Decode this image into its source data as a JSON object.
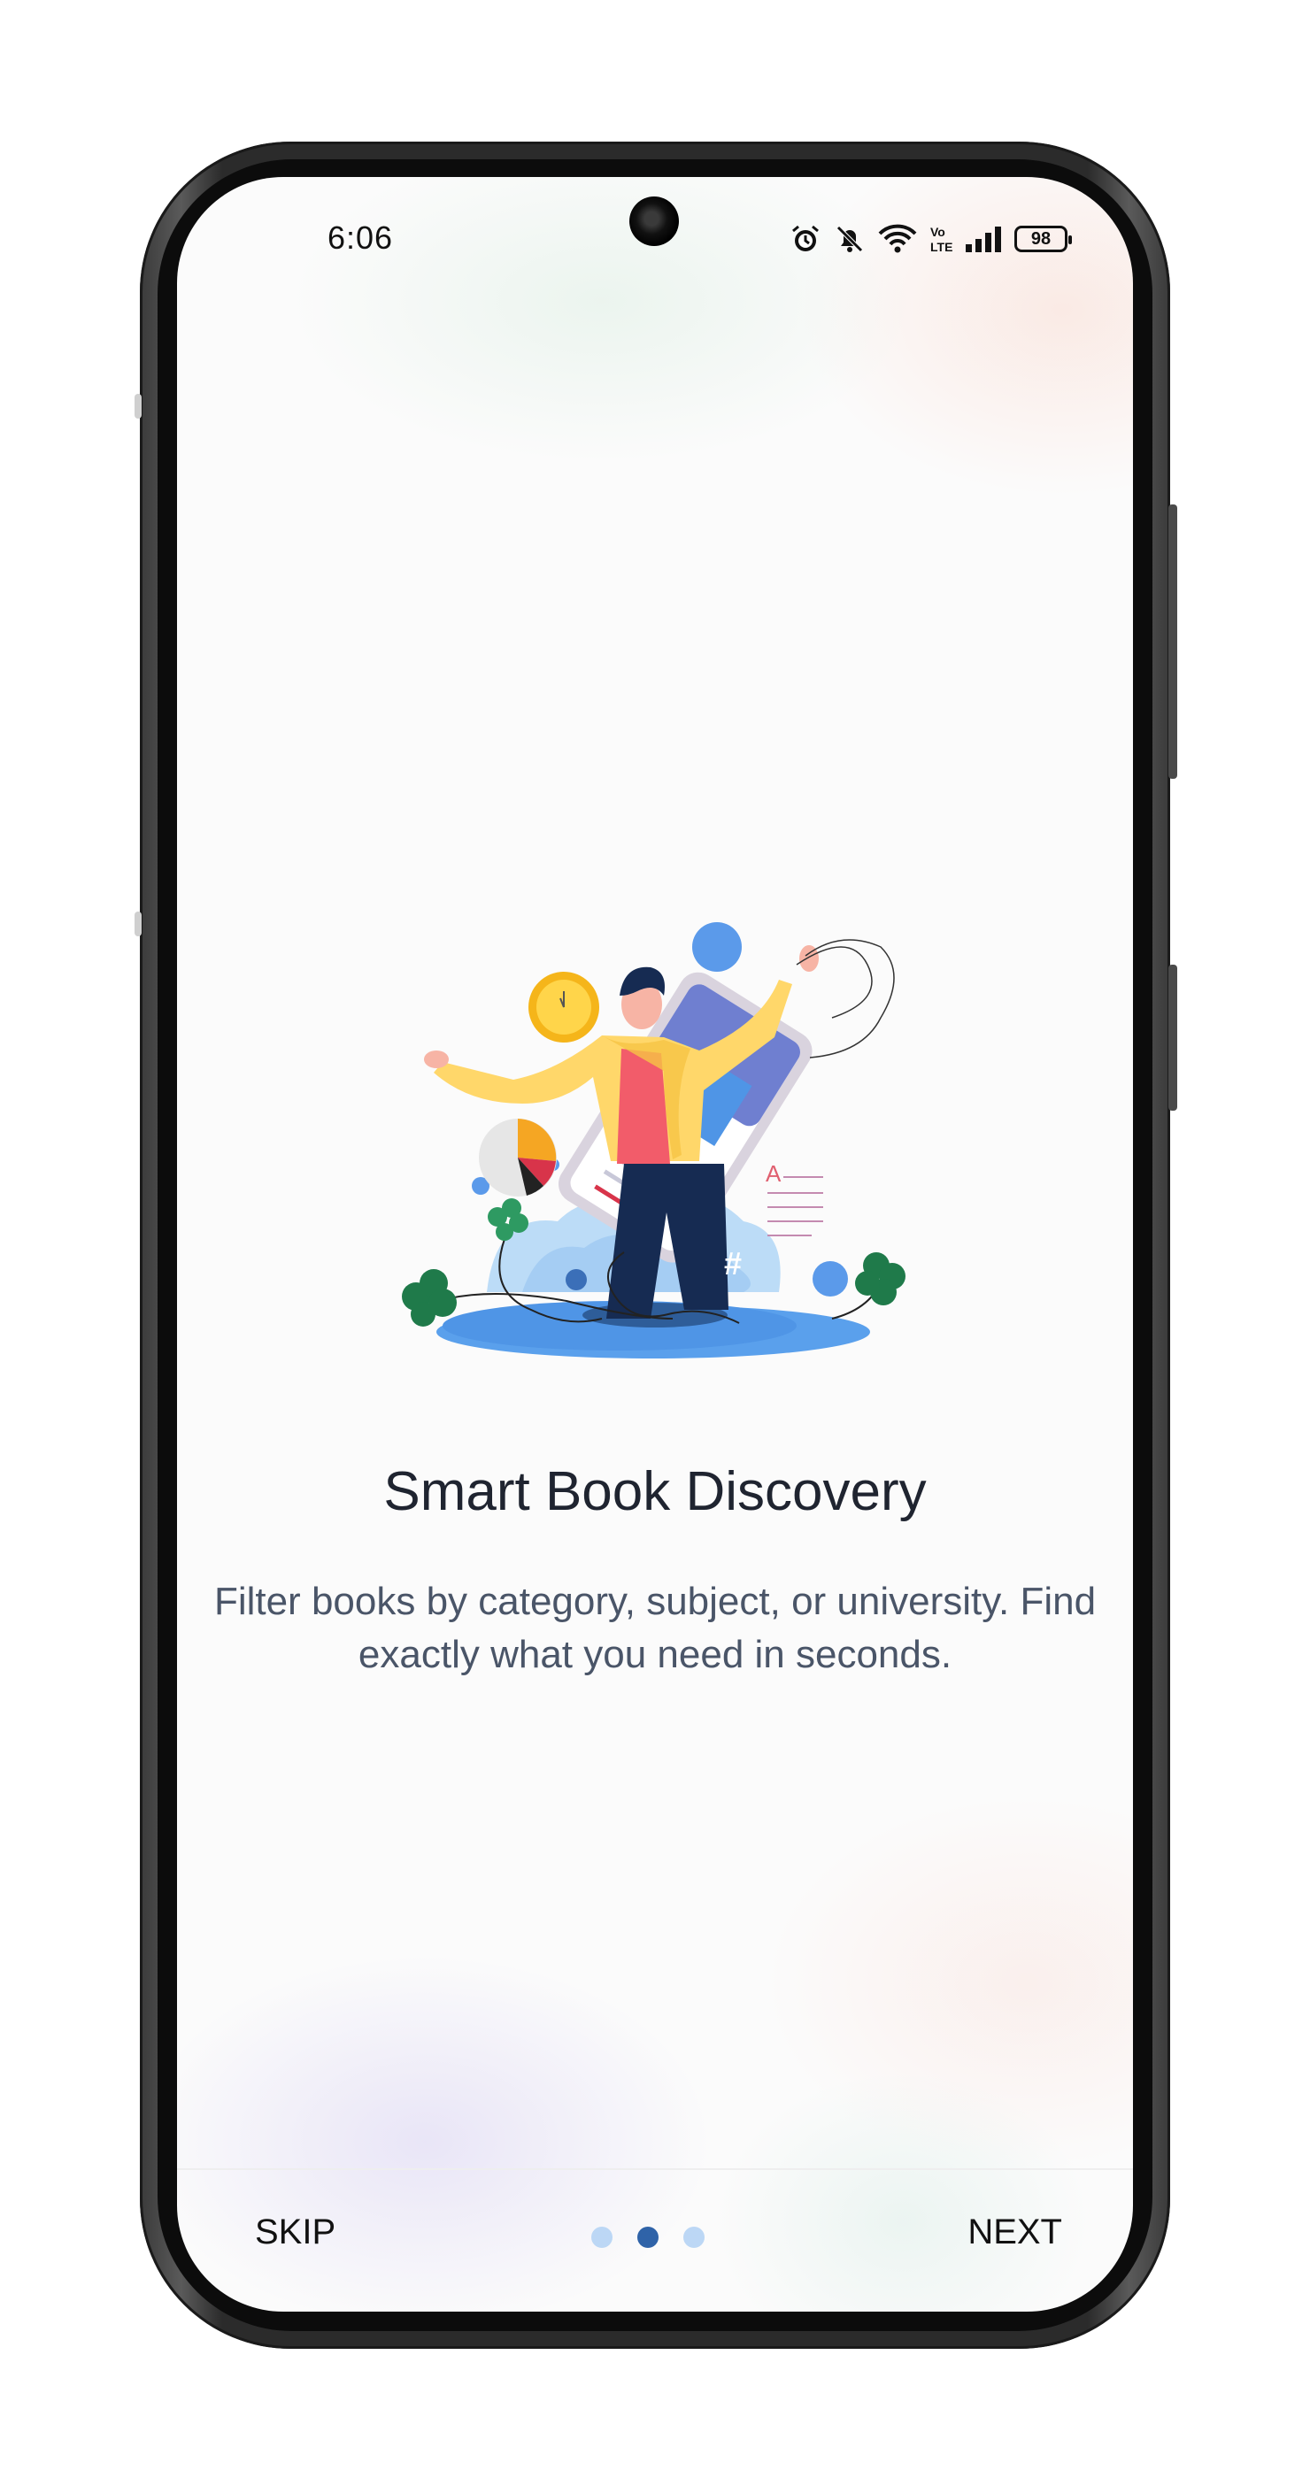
{
  "status_bar": {
    "time": "6:06",
    "battery": "98",
    "icons": [
      "alarm-icon",
      "bell-off-icon",
      "wifi-icon",
      "volte-icon",
      "signal-icon",
      "battery-icon"
    ],
    "volte_text": "Vo LTE"
  },
  "onboarding": {
    "title": "Smart Book Discovery",
    "description": "Filter books by category, subject, or university. Find exactly what you need in seconds.",
    "illustration": "person-reading-from-phone-illustration",
    "page_indicator": {
      "total": 3,
      "current": 2
    }
  },
  "footer": {
    "skip_label": "SKIP",
    "next_label": "NEXT"
  },
  "colors": {
    "accent": "#2F63A8",
    "dot_inactive": "#BCD7F5",
    "title": "#1F2430",
    "text": "#4A5568"
  }
}
